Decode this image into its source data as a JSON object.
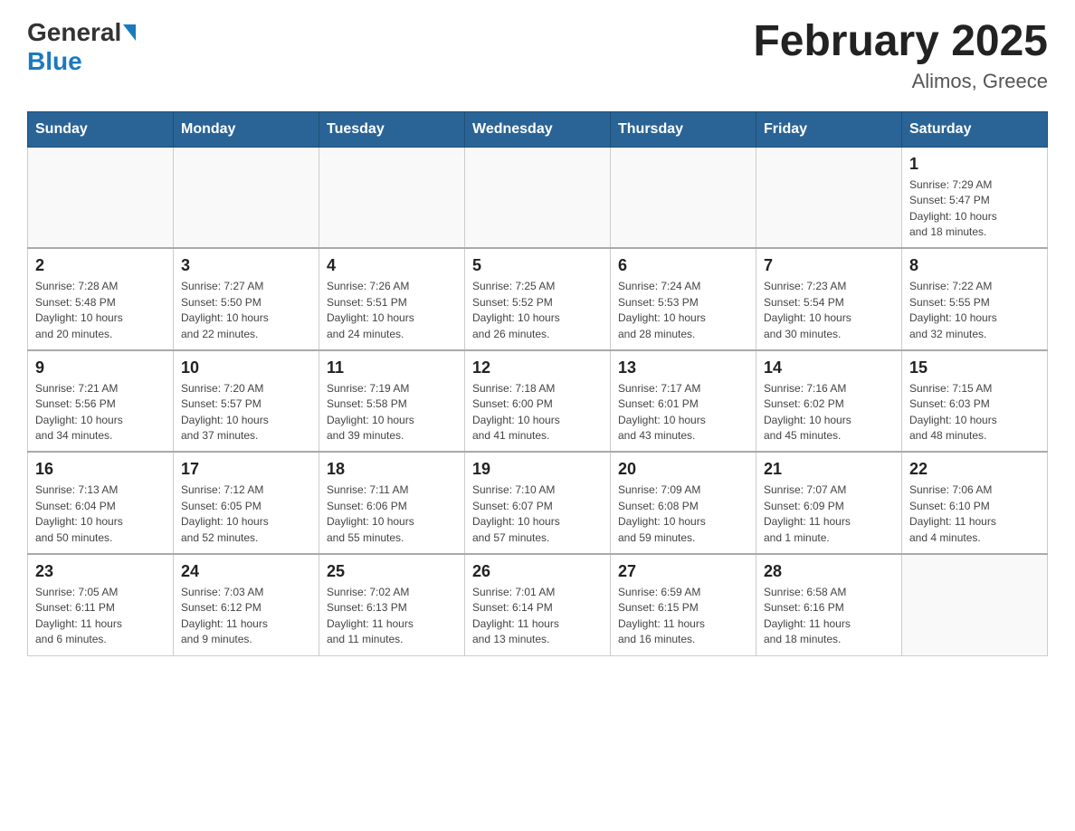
{
  "header": {
    "logo": {
      "general": "General",
      "blue": "Blue"
    },
    "title": "February 2025",
    "subtitle": "Alimos, Greece"
  },
  "weekdays": [
    "Sunday",
    "Monday",
    "Tuesday",
    "Wednesday",
    "Thursday",
    "Friday",
    "Saturday"
  ],
  "weeks": [
    [
      {
        "day": "",
        "info": ""
      },
      {
        "day": "",
        "info": ""
      },
      {
        "day": "",
        "info": ""
      },
      {
        "day": "",
        "info": ""
      },
      {
        "day": "",
        "info": ""
      },
      {
        "day": "",
        "info": ""
      },
      {
        "day": "1",
        "info": "Sunrise: 7:29 AM\nSunset: 5:47 PM\nDaylight: 10 hours\nand 18 minutes."
      }
    ],
    [
      {
        "day": "2",
        "info": "Sunrise: 7:28 AM\nSunset: 5:48 PM\nDaylight: 10 hours\nand 20 minutes."
      },
      {
        "day": "3",
        "info": "Sunrise: 7:27 AM\nSunset: 5:50 PM\nDaylight: 10 hours\nand 22 minutes."
      },
      {
        "day": "4",
        "info": "Sunrise: 7:26 AM\nSunset: 5:51 PM\nDaylight: 10 hours\nand 24 minutes."
      },
      {
        "day": "5",
        "info": "Sunrise: 7:25 AM\nSunset: 5:52 PM\nDaylight: 10 hours\nand 26 minutes."
      },
      {
        "day": "6",
        "info": "Sunrise: 7:24 AM\nSunset: 5:53 PM\nDaylight: 10 hours\nand 28 minutes."
      },
      {
        "day": "7",
        "info": "Sunrise: 7:23 AM\nSunset: 5:54 PM\nDaylight: 10 hours\nand 30 minutes."
      },
      {
        "day": "8",
        "info": "Sunrise: 7:22 AM\nSunset: 5:55 PM\nDaylight: 10 hours\nand 32 minutes."
      }
    ],
    [
      {
        "day": "9",
        "info": "Sunrise: 7:21 AM\nSunset: 5:56 PM\nDaylight: 10 hours\nand 34 minutes."
      },
      {
        "day": "10",
        "info": "Sunrise: 7:20 AM\nSunset: 5:57 PM\nDaylight: 10 hours\nand 37 minutes."
      },
      {
        "day": "11",
        "info": "Sunrise: 7:19 AM\nSunset: 5:58 PM\nDaylight: 10 hours\nand 39 minutes."
      },
      {
        "day": "12",
        "info": "Sunrise: 7:18 AM\nSunset: 6:00 PM\nDaylight: 10 hours\nand 41 minutes."
      },
      {
        "day": "13",
        "info": "Sunrise: 7:17 AM\nSunset: 6:01 PM\nDaylight: 10 hours\nand 43 minutes."
      },
      {
        "day": "14",
        "info": "Sunrise: 7:16 AM\nSunset: 6:02 PM\nDaylight: 10 hours\nand 45 minutes."
      },
      {
        "day": "15",
        "info": "Sunrise: 7:15 AM\nSunset: 6:03 PM\nDaylight: 10 hours\nand 48 minutes."
      }
    ],
    [
      {
        "day": "16",
        "info": "Sunrise: 7:13 AM\nSunset: 6:04 PM\nDaylight: 10 hours\nand 50 minutes."
      },
      {
        "day": "17",
        "info": "Sunrise: 7:12 AM\nSunset: 6:05 PM\nDaylight: 10 hours\nand 52 minutes."
      },
      {
        "day": "18",
        "info": "Sunrise: 7:11 AM\nSunset: 6:06 PM\nDaylight: 10 hours\nand 55 minutes."
      },
      {
        "day": "19",
        "info": "Sunrise: 7:10 AM\nSunset: 6:07 PM\nDaylight: 10 hours\nand 57 minutes."
      },
      {
        "day": "20",
        "info": "Sunrise: 7:09 AM\nSunset: 6:08 PM\nDaylight: 10 hours\nand 59 minutes."
      },
      {
        "day": "21",
        "info": "Sunrise: 7:07 AM\nSunset: 6:09 PM\nDaylight: 11 hours\nand 1 minute."
      },
      {
        "day": "22",
        "info": "Sunrise: 7:06 AM\nSunset: 6:10 PM\nDaylight: 11 hours\nand 4 minutes."
      }
    ],
    [
      {
        "day": "23",
        "info": "Sunrise: 7:05 AM\nSunset: 6:11 PM\nDaylight: 11 hours\nand 6 minutes."
      },
      {
        "day": "24",
        "info": "Sunrise: 7:03 AM\nSunset: 6:12 PM\nDaylight: 11 hours\nand 9 minutes."
      },
      {
        "day": "25",
        "info": "Sunrise: 7:02 AM\nSunset: 6:13 PM\nDaylight: 11 hours\nand 11 minutes."
      },
      {
        "day": "26",
        "info": "Sunrise: 7:01 AM\nSunset: 6:14 PM\nDaylight: 11 hours\nand 13 minutes."
      },
      {
        "day": "27",
        "info": "Sunrise: 6:59 AM\nSunset: 6:15 PM\nDaylight: 11 hours\nand 16 minutes."
      },
      {
        "day": "28",
        "info": "Sunrise: 6:58 AM\nSunset: 6:16 PM\nDaylight: 11 hours\nand 18 minutes."
      },
      {
        "day": "",
        "info": ""
      }
    ]
  ]
}
